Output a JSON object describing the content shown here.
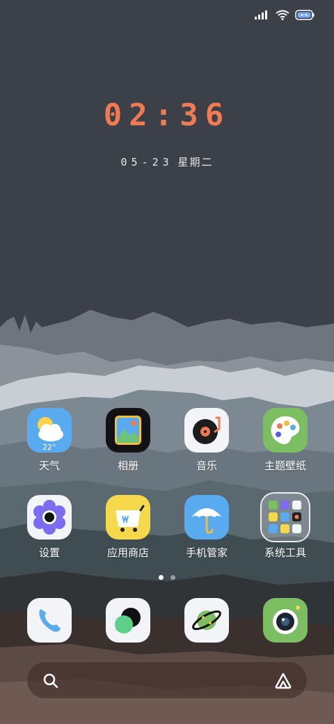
{
  "status": {
    "signal_icon": "signal-icon",
    "wifi_icon": "wifi-icon",
    "battery_icon": "battery-icon"
  },
  "clock": {
    "time": "02:36"
  },
  "date": {
    "day": "05-23",
    "weekday": "星期二"
  },
  "apps_row1": [
    {
      "label": "天气",
      "icon": "weather-icon",
      "temp": "22°"
    },
    {
      "label": "相册",
      "icon": "gallery-icon"
    },
    {
      "label": "音乐",
      "icon": "music-icon"
    },
    {
      "label": "主题壁纸",
      "icon": "palette-icon"
    }
  ],
  "apps_row2": [
    {
      "label": "设置",
      "icon": "settings-icon"
    },
    {
      "label": "应用商店",
      "icon": "app-store-icon"
    },
    {
      "label": "手机管家",
      "icon": "phone-manager-icon"
    },
    {
      "label": "系统工具",
      "icon": "folder-icon"
    }
  ],
  "pages": {
    "count": 2,
    "current": 1
  },
  "dock": [
    "phone-icon",
    "messages-icon",
    "browser-icon",
    "camera-icon"
  ],
  "colors": {
    "clock": "#f07a52",
    "accent_blue": "#5aaaf0"
  }
}
